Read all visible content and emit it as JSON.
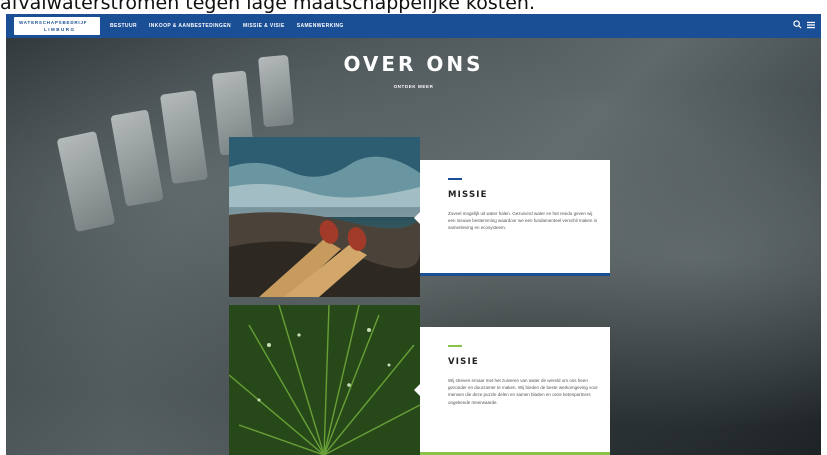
{
  "caption": "afvalwaterstromen tegen lage maatschappelijke kosten.",
  "header": {
    "logo_line1": "WATERSCHAPSBEDRIJF",
    "logo_line2": "LIMBURG",
    "menu": [
      "BESTUUR",
      "INKOOP & AANBESTEDINGEN",
      "MISSIE & VISIE",
      "SAMENWERKING"
    ],
    "icons": [
      "search-icon",
      "menu-icon"
    ],
    "accent_color": "#1a4f96"
  },
  "hero": {
    "title": "OVER ONS",
    "link": "ONTDEK MEER"
  },
  "sections": [
    {
      "title": "MISSIE",
      "text": "Zoveel mogelijk uit water halen. Gezuiverd water en het residu geven wij een nieuwe bestemming waardoor we een fundamenteel verschil maken in samenleving en ecosysteem.",
      "accent_color": "#1a4f96"
    },
    {
      "title": "VISIE",
      "text": "Wij streven ernaar met het zuiveren van water de wereld om ons heen gezonder en duurzamer te maken. Wij bieden de beste werkomgeving voor mensen die deze puzzle delen en samen bladen en onze ketenpartners ongekende meerwaarde.",
      "accent_color": "#8bc34a"
    }
  ]
}
